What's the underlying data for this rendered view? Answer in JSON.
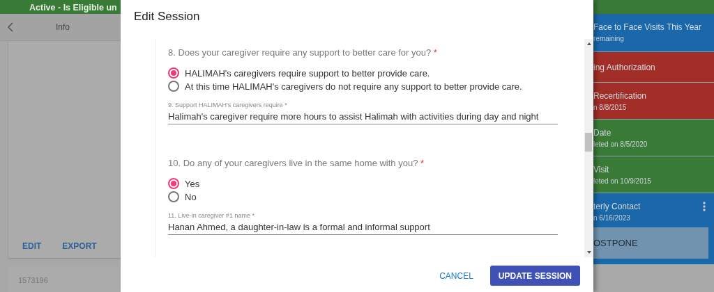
{
  "background": {
    "header_title": "Active - Is Eligible un",
    "left_panel": {
      "title": "Info",
      "actions": [
        "EDIT",
        "EXPORT"
      ],
      "record_id": "1573196"
    },
    "right_panel": {
      "items": [
        {
          "title": "Face to Face Visits This Year",
          "subtitle": "remaining",
          "color": "#1a67a9",
          "menu": false
        },
        {
          "title": "ing Authorization",
          "color": "#a22e27",
          "menu": false
        },
        {
          "title": "Recertification",
          "subtitle": "n 8/8/2015",
          "color": "#a22e27",
          "menu": false
        },
        {
          "title": "Date",
          "subtitle": "leted on 8/5/2020",
          "color": "#3a7a37",
          "menu": false
        },
        {
          "title": "Visit",
          "subtitle": "leted on 10/9/2015",
          "color": "#3a7a37",
          "menu": false
        },
        {
          "title": "terly Contact",
          "subtitle": "n 6/16/2023",
          "color": "#1a67a9",
          "menu": true,
          "action": "OSTPONE"
        }
      ]
    }
  },
  "dialog": {
    "title": "Edit Session",
    "questions": [
      {
        "kind": "radio",
        "label": "8. Does your caregiver require any support to better care for you?",
        "required_mark": "*",
        "options": [
          {
            "label": "HALIMAH's caregivers require support to better provide care.",
            "selected": true
          },
          {
            "label": "At this time HALIMAH's caregivers do not require any support to better provide care.",
            "selected": false
          }
        ]
      },
      {
        "kind": "text",
        "label": "9. Support HALIMAH's caregivers require",
        "required_mark": "*",
        "value": "Halimah's caregiver require more hours to assist Halimah with activities during day and night"
      },
      {
        "kind": "radio",
        "label": "10. Do any of your caregivers live in the same home with you?",
        "required_mark": "*",
        "options": [
          {
            "label": "Yes",
            "selected": true
          },
          {
            "label": "No",
            "selected": false
          }
        ]
      },
      {
        "kind": "text",
        "label": "11. Live-in caregiver #1 name",
        "required_mark": "*",
        "value": "Hanan Ahmed, a daughter-in-law is a formal and informal support"
      }
    ],
    "buttons": [
      {
        "label": "CANCEL",
        "kind": "text"
      },
      {
        "label": "UPDATE SESSION",
        "kind": "primary"
      }
    ]
  }
}
